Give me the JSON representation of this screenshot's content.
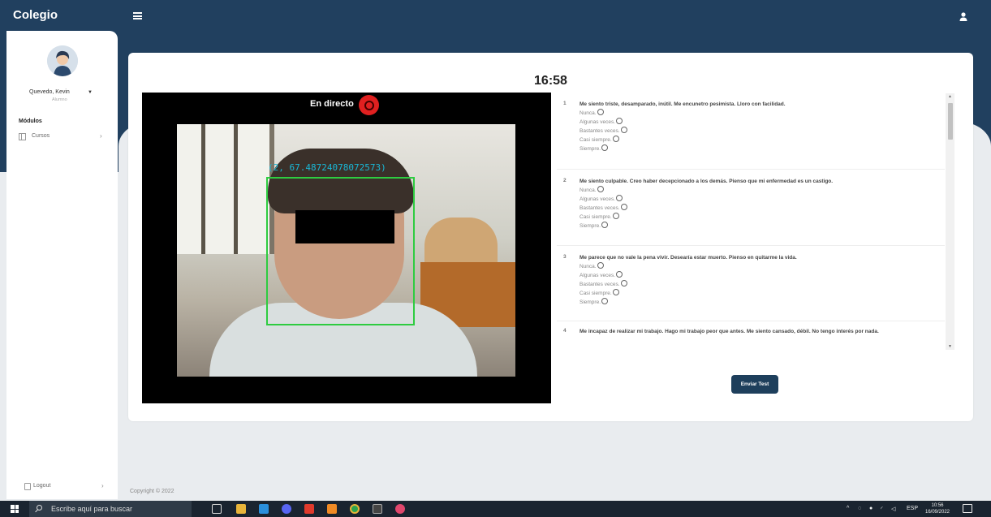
{
  "header": {
    "brand": "Colegio",
    "menu_icon": "hamburger-icon",
    "user_icon": "user-icon"
  },
  "sidebar": {
    "user_name": "Quevedo, Kevin",
    "user_role": "Alumno",
    "section_label": "Módulos",
    "items": [
      {
        "label": "Cursos",
        "icon": "table-icon"
      }
    ],
    "logout_label": "Logout"
  },
  "main": {
    "timer": "16:58",
    "live_label": "En directo",
    "detection_text": "(2, 67.48724078072573)",
    "questions": [
      {
        "number": "1",
        "text": "Me siento triste, desamparado, inútil. Me encunetro pesimista. Lloro con facilidad.",
        "options": [
          "Nunca.",
          "Algunas veces.",
          "Bastantes veces.",
          "Casi siempre.",
          "Siempre."
        ]
      },
      {
        "number": "2",
        "text": "Me siento culpable. Creo haber decepcionado a los demás. Pienso que mi enfermedad es un castigo.",
        "options": [
          "Nunca.",
          "Algunas veces.",
          "Bastantes veces.",
          "Casi siempre.",
          "Siempre."
        ]
      },
      {
        "number": "3",
        "text": "Me parece que no vale la pena vivir. Desearía estar muerto. Pienso en quitarme la vida.",
        "options": [
          "Nunca.",
          "Algunas veces.",
          "Bastantes veces.",
          "Casi siempre.",
          "Siempre."
        ]
      },
      {
        "number": "4",
        "text": "Me incapaz de realizar mi trabajo. Hago mi trabajo peor que antes. Me siento cansado, débil. No tengo interés por nada.",
        "options": []
      }
    ],
    "send_button": "Enviar Test"
  },
  "footer": {
    "copyright": "Copyright © 2022"
  },
  "taskbar": {
    "search_placeholder": "Escribe aquí para buscar",
    "language": "ESP",
    "time": "10:56",
    "date": "16/09/2022"
  },
  "colors": {
    "header_bg": "#21405f",
    "button_bg": "#1e3f5c",
    "live_red": "#e02020",
    "face_box": "#2ecc40",
    "detection_text": "#19b7d6"
  }
}
